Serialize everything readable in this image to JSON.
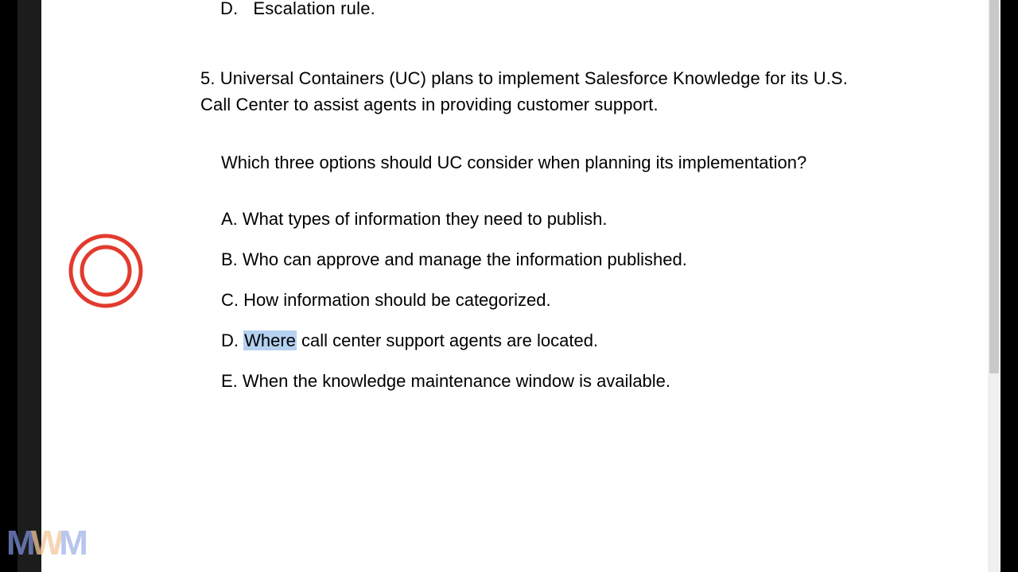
{
  "question4": {
    "options": {
      "D": {
        "letter": "D.",
        "text": "Escalation rule."
      }
    }
  },
  "question5": {
    "number": "5.",
    "stem": "Universal Containers (UC) plans to implement Salesforce Knowledge for its U.S. Call Center to assist agents in providing customer support.",
    "sub": "Which three options should UC consider when planning its implementation?",
    "options": {
      "A": {
        "letter": "A.",
        "text": "What types of information they need to publish."
      },
      "B": {
        "letter": "B.",
        "text": "Who can approve and manage the information published."
      },
      "C": {
        "letter": "C.",
        "text": "How information should be categorized."
      },
      "D": {
        "letter": "D.",
        "highlighted_word": "Where",
        "rest": " call center support agents are located."
      },
      "E": {
        "letter": "E.",
        "text": "When the knowledge maintenance window is available."
      }
    }
  },
  "annotation": {
    "type": "double-circle",
    "stroke": "#e23b2e"
  },
  "logo": {
    "m1": "M",
    "w": "W",
    "m2": "M"
  }
}
